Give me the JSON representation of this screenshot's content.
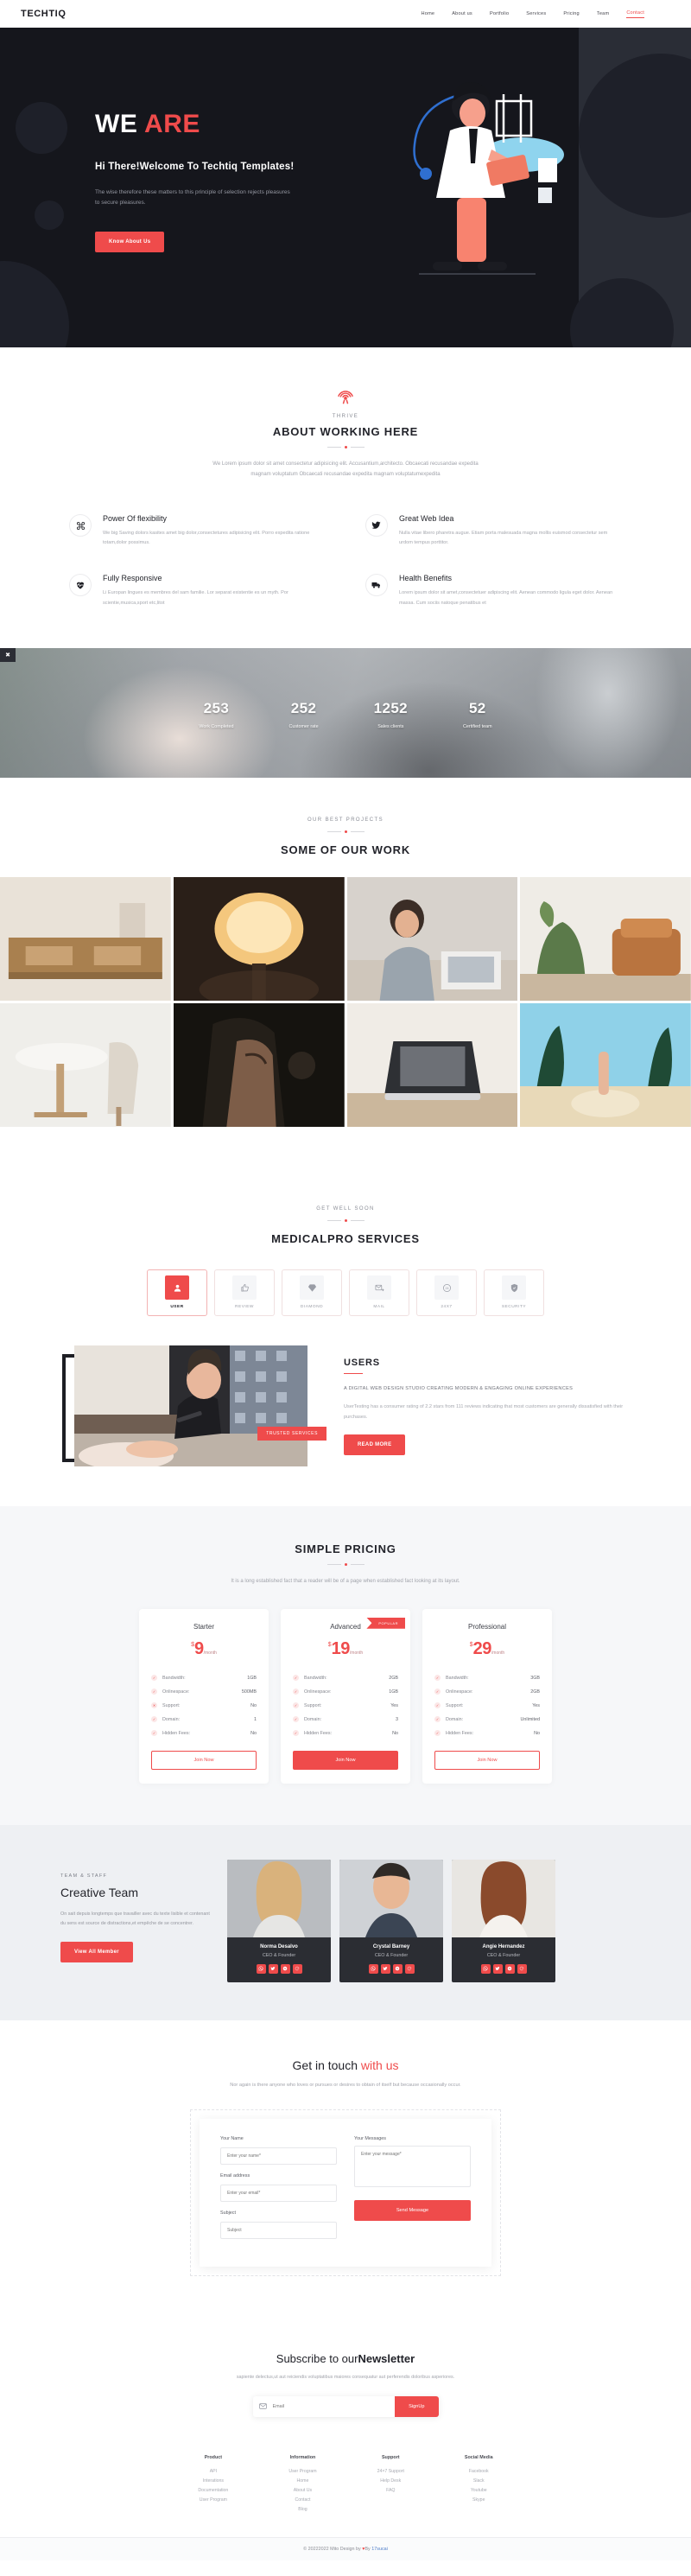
{
  "header": {
    "logo": "TECHTIQ",
    "nav": [
      {
        "label": "Home",
        "active": false
      },
      {
        "label": "About us",
        "active": false
      },
      {
        "label": "Portfolio",
        "active": false
      },
      {
        "label": "Services",
        "active": false
      },
      {
        "label": "Pricing",
        "active": false
      },
      {
        "label": "Team",
        "active": false
      },
      {
        "label": "Contact",
        "active": true
      }
    ]
  },
  "hero": {
    "title_plain": "WE ",
    "title_accent": "ARE",
    "subtitle": "Hi There!Welcome To Techtiq Templates!",
    "description": "The wise therefore these matters to this principle of selection rejects pleasures to secure pleasures.",
    "cta": "Know About Us"
  },
  "about": {
    "icon": "broadcast-icon",
    "label": "THRIVE",
    "title": "ABOUT WORKING HERE",
    "description": "We Lorem ipsum dolor sit amet consectetur adipisicing elit. Accusantium,architecto. Obcaecati recusandae expedita magnam voluptatum Obcaecati recusandae expedita magnam voluptatumexpedita",
    "features": [
      {
        "icon": "command-icon",
        "title": "Power Of flexibility",
        "text": "We big Saving dolors kasites amet big dolor,consectetures adipisicing elit. Porro expedita ratione totam,dolor possimus."
      },
      {
        "icon": "bird-icon",
        "title": "Great Web Idea",
        "text": "Nulla vitae libero pharetra augue. Etiam porta malesuada magna mollis euismod consectetur sem urdom tempus porttitor."
      },
      {
        "icon": "heartbeat-icon",
        "title": "Fully Responsive",
        "text": "Li Europan lingues es membres del sam familie. Lor separat existentie es un myth. Por scientie,musica,sport etc,litot"
      },
      {
        "icon": "truck-icon",
        "title": "Health Benefits",
        "text": "Lorem ipsum dolor sit amet,consectetuer adipiscing elit. Aenean commodo ligula eget dolor. Aenean massa. Cum sociis natoque penatibus et"
      }
    ]
  },
  "counter": {
    "close_icon": "close-icon",
    "stats": [
      {
        "number": "253",
        "label": "Work Completed"
      },
      {
        "number": "252",
        "label": "Customer rate"
      },
      {
        "number": "1252",
        "label": "Sales clients"
      },
      {
        "number": "52",
        "label": "Certified team"
      }
    ]
  },
  "portfolio": {
    "label": "OUR BEST PROJECTS",
    "title": "SOME OF OUR WORK",
    "items": [
      {
        "alt": "wooden-sideboard-living-room"
      },
      {
        "alt": "wall-lamp-warm-light"
      },
      {
        "alt": "woman-working-at-desk"
      },
      {
        "alt": "plant-and-armchair-corner"
      },
      {
        "alt": "round-table-and-chair"
      },
      {
        "alt": "man-with-tattooed-arms"
      },
      {
        "alt": "laptop-on-desk"
      },
      {
        "alt": "beach-palm-trees-hand"
      }
    ]
  },
  "services": {
    "label": "GET WELL SOON",
    "title": "MEDICALPRO SERVICES",
    "tabs": [
      {
        "label": "USER",
        "icon": "user-icon",
        "active": true
      },
      {
        "label": "REVIEW",
        "icon": "thumbs-up-icon",
        "active": false
      },
      {
        "label": "DIAMOND",
        "icon": "diamond-icon",
        "active": false
      },
      {
        "label": "MAIL",
        "icon": "mail-icon",
        "active": false
      },
      {
        "label": "24X7",
        "icon": "clock-24-icon",
        "active": false
      },
      {
        "label": "SECURITY",
        "icon": "shield-icon",
        "active": false
      }
    ],
    "image_tag": "TRUSTED SERVICES",
    "panel": {
      "title": "USERS",
      "upper": "A DIGITAL WEB DESIGN STUDIO CREATING MODERN & ENGAGING ONLINE EXPERIENCES",
      "text": "UserTesting has a consumer rating of 2.2 stars from 111 reviews indicating that most customers are generally dissatisfied with their purchases.",
      "cta": "READ MORE"
    }
  },
  "pricing": {
    "title": "SIMPLE PRICING",
    "description": "It is a long established fact that a reader will be of a page when established fact looking at its layout.",
    "plans": [
      {
        "name": "Starter",
        "currency": "$",
        "amount": "9",
        "period": "/month",
        "badge": "",
        "cta": "Join Now",
        "featured": false,
        "rows": [
          {
            "label": "Bandwidth:",
            "value": "1GB",
            "ok": true
          },
          {
            "label": "Onlinespace:",
            "value": "500MB",
            "ok": true
          },
          {
            "label": "Support:",
            "value": "No",
            "ok": false
          },
          {
            "label": "Domain:",
            "value": "1",
            "ok": true
          },
          {
            "label": "Hidden Fees:",
            "value": "No",
            "ok": true
          }
        ]
      },
      {
        "name": "Advanced",
        "currency": "$",
        "amount": "19",
        "period": "/month",
        "badge": "POPULAR",
        "cta": "Join Now",
        "featured": true,
        "rows": [
          {
            "label": "Bandwidth:",
            "value": "2GB",
            "ok": true
          },
          {
            "label": "Onlinespace:",
            "value": "1GB",
            "ok": true
          },
          {
            "label": "Support:",
            "value": "Yes",
            "ok": true
          },
          {
            "label": "Domain:",
            "value": "3",
            "ok": true
          },
          {
            "label": "Hidden Fees:",
            "value": "No",
            "ok": true
          }
        ]
      },
      {
        "name": "Professional",
        "currency": "$",
        "amount": "29",
        "period": "/month",
        "badge": "",
        "cta": "Join Now",
        "featured": false,
        "rows": [
          {
            "label": "Bandwidth:",
            "value": "3GB",
            "ok": true
          },
          {
            "label": "Onlinespace:",
            "value": "2GB",
            "ok": true
          },
          {
            "label": "Support:",
            "value": "Yes",
            "ok": true
          },
          {
            "label": "Domain:",
            "value": "Unlimited",
            "ok": true
          },
          {
            "label": "Hidden Fees:",
            "value": "No",
            "ok": true
          }
        ]
      }
    ]
  },
  "team": {
    "label": "TEAM & STAFF",
    "title": "Creative Team",
    "description": "On sait depuis longtemps que travailler avec du texte lisible et contenant du sens est source de distractions,et empêche de se concentrer.",
    "cta": "View All Member",
    "members": [
      {
        "name": "Norma Desalvo",
        "role": "CEO & Founder",
        "socials": [
          "whatsapp-icon",
          "twitter-icon",
          "skype-icon",
          "google-icon"
        ]
      },
      {
        "name": "Crystal Barney",
        "role": "CEO & Founder",
        "socials": [
          "whatsapp-icon",
          "twitter-icon",
          "skype-icon",
          "google-icon"
        ]
      },
      {
        "name": "Angie Hernandez",
        "role": "CEO & Founder",
        "socials": [
          "whatsapp-icon",
          "twitter-icon",
          "skype-icon",
          "google-icon"
        ]
      }
    ]
  },
  "contact": {
    "title_plain": "Get in touch ",
    "title_accent": "with us",
    "description": "Nor again is there anyone who loves or pursues or desires to obtain of itself but because occasionally occur.",
    "name_label": "Your Name",
    "name_placeholder": "Enter your name*",
    "email_label": "Email address",
    "email_placeholder": "Enter your email*",
    "subject_label": "Subject",
    "subject_placeholder": "Subject",
    "message_label": "Your Messages",
    "message_placeholder": "Enter your message*",
    "send": "Send Message"
  },
  "newsletter": {
    "title_plain": "Subscribe to our",
    "title_bold": "Newsletter",
    "description": "sapiente delectus,ut aut reiciendis voluptatibus maiores consequatur aut perferendis doloribus asperiores.",
    "icon": "envelope-icon",
    "placeholder": "Email",
    "cta": "SignUp"
  },
  "footer": {
    "columns": [
      {
        "title": "Product",
        "links": [
          "API",
          "Interations",
          "Documentation",
          "User Program"
        ]
      },
      {
        "title": "Information",
        "links": [
          "User Program",
          "Home",
          "About Us",
          "Contact",
          "Blog"
        ]
      },
      {
        "title": "Support",
        "links": [
          "24×7 Support",
          "Help Desk",
          "FAQ"
        ]
      },
      {
        "title": "Social Media",
        "links": [
          "Facebook",
          "Slack",
          "Youtube",
          "Skype"
        ]
      }
    ],
    "copyright_pre": "© 20222022 Mito Design by ",
    "copyright_heart": "♥",
    "copyright_mid": "By ",
    "copyright_link": "17sucai"
  },
  "colors": {
    "accent": "#ef4b4b",
    "dark": "#15161c",
    "muted": "#a1a3ab"
  }
}
